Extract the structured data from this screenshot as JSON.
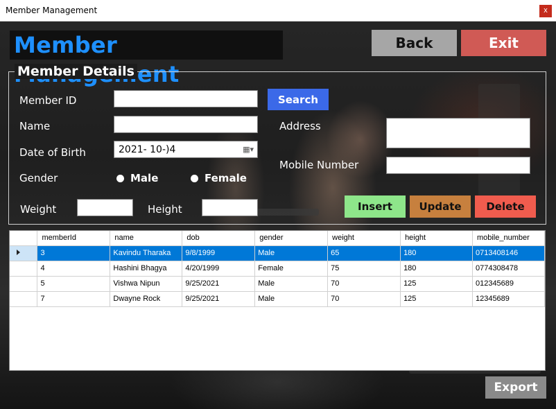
{
  "window": {
    "title": "Member Management",
    "close_label": "x"
  },
  "header": {
    "title": "Member Management",
    "back_label": "Back",
    "exit_label": "Exit"
  },
  "details": {
    "legend": "Member Details",
    "member_id_label": "Member ID",
    "member_id_value": "",
    "search_label": "Search",
    "name_label": "Name",
    "name_value": "",
    "dob_label": "Date of Birth",
    "dob_value": "2021- 10-)4",
    "gender_label": "Gender",
    "gender_male": "Male",
    "gender_female": "Female",
    "address_label": "Address",
    "address_value": "",
    "mobile_label": "Mobile Number",
    "mobile_value": "",
    "weight_label": "Weight",
    "weight_value": "",
    "height_label": "Height",
    "height_value": "",
    "insert_label": "Insert",
    "update_label": "Update",
    "delete_label": "Delete"
  },
  "table": {
    "columns": [
      "memberId",
      "name",
      "dob",
      "gender",
      "weight",
      "height",
      "mobile_number"
    ],
    "rows": [
      [
        "3",
        "Kavindu Tharaka",
        "9/8/1999",
        "Male",
        "65",
        "180",
        "0713408146"
      ],
      [
        "4",
        "Hashini Bhagya",
        "4/20/1999",
        "Female",
        "75",
        "180",
        "0774308478"
      ],
      [
        "5",
        "Vishwa Nipun",
        "9/25/2021",
        "Male",
        "70",
        "125",
        "012345689"
      ],
      [
        "7",
        "Dwayne Rock",
        "9/25/2021",
        "Male",
        "70",
        "125",
        "12345689"
      ]
    ]
  },
  "footer": {
    "export_label": "Export"
  },
  "colors": {
    "title_blue": "#1e90ff",
    "selection": "#0078d7",
    "search": "#3b69e8",
    "insert": "#8ee68a",
    "update": "#c7803e",
    "delete": "#f05c4e",
    "exit": "#d05a55"
  }
}
